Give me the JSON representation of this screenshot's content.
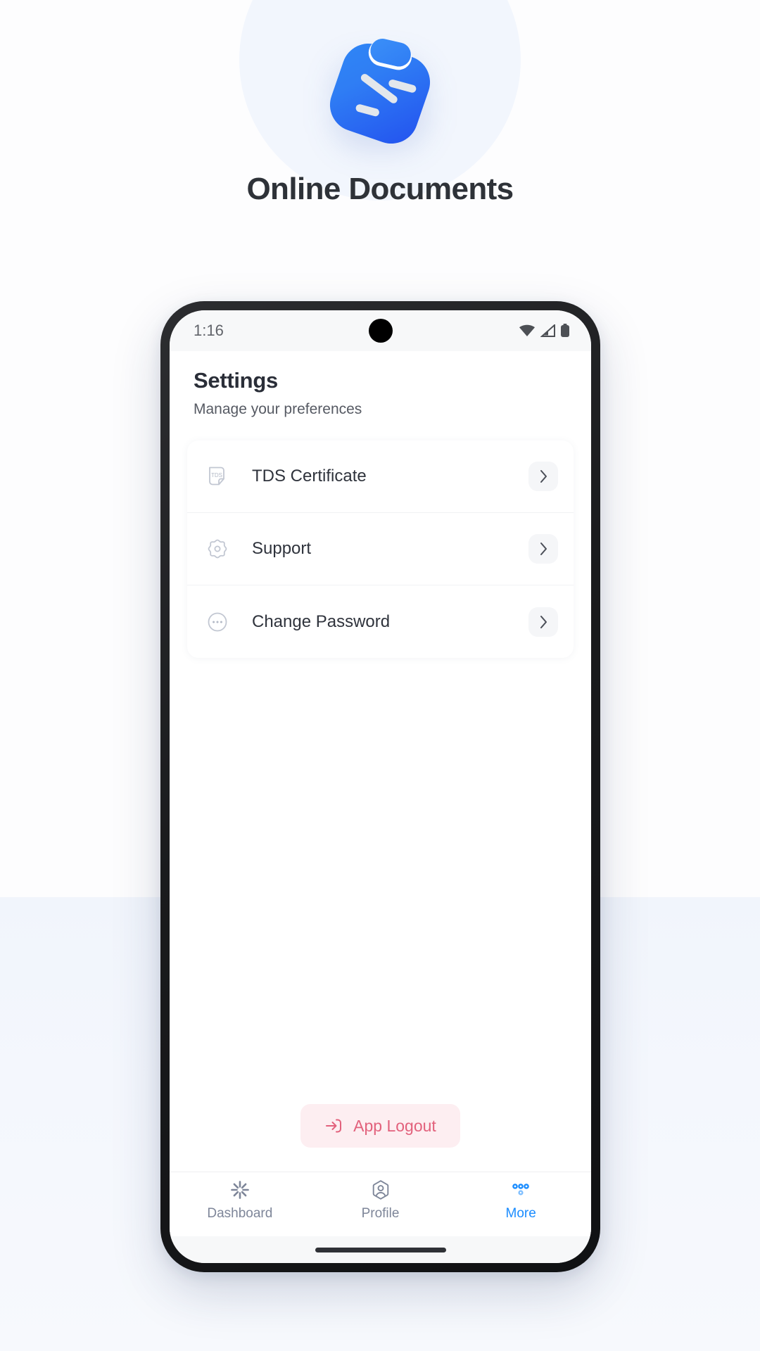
{
  "brand": {
    "title": "Online Documents",
    "logo_icon": "clipboard-document-icon",
    "logo_color_start": "#2f86f6",
    "logo_color_end": "#2352ef"
  },
  "statusbar": {
    "time": "1:16",
    "icons": [
      "wifi-icon",
      "cellular-signal-icon",
      "battery-icon"
    ]
  },
  "header": {
    "title": "Settings",
    "subtitle": "Manage your preferences"
  },
  "settings": {
    "items": [
      {
        "label": "TDS Certificate",
        "icon": "tds-document-icon",
        "icon_text": "TDS",
        "chevron": "chevron-right-icon"
      },
      {
        "label": "Support",
        "icon": "gear-icon",
        "chevron": "chevron-right-icon"
      },
      {
        "label": "Change Password",
        "icon": "ellipsis-circle-icon",
        "chevron": "chevron-right-icon"
      }
    ]
  },
  "logout": {
    "label": "App Logout",
    "icon": "logout-arrow-icon",
    "text_color": "#e2617c",
    "bg_color": "#fdeef1"
  },
  "bottom_nav": {
    "active_color": "#1a8cff",
    "inactive_color": "#7e8699",
    "items": [
      {
        "label": "Dashboard",
        "icon": "starburst-icon",
        "active": false
      },
      {
        "label": "Profile",
        "icon": "person-hexagon-icon",
        "active": false
      },
      {
        "label": "More",
        "icon": "four-dots-icon",
        "active": true
      }
    ]
  }
}
